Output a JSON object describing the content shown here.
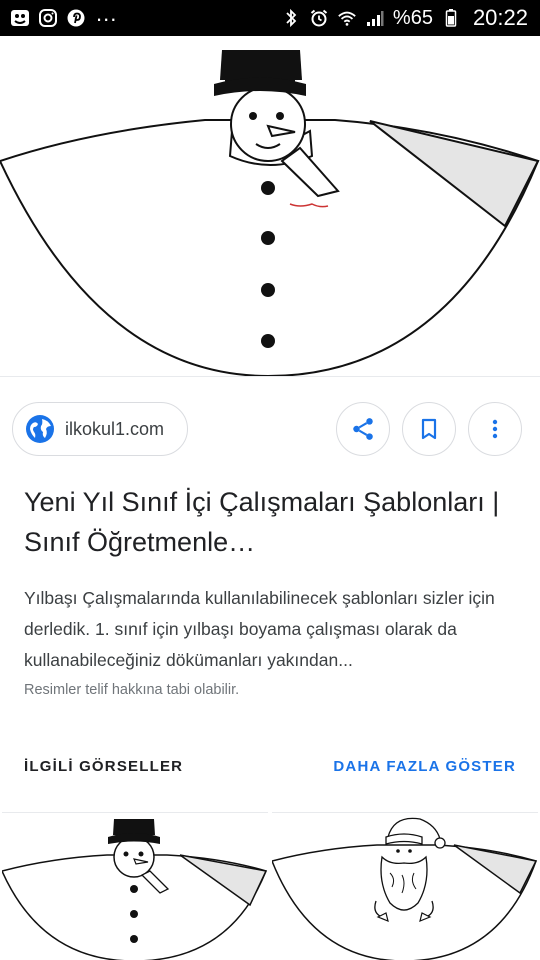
{
  "status_bar": {
    "left_icons": [
      "app-icon",
      "instagram-icon",
      "pinterest-icon"
    ],
    "overflow": "...",
    "right_icons": [
      "bluetooth-icon",
      "alarm-icon",
      "wifi-icon",
      "signal-icon"
    ],
    "battery": "%65",
    "time": "20:22"
  },
  "result": {
    "source": "ilkokul1.com",
    "title": "Yeni Yıl Sınıf İçi Çalışmaları Şablonları | Sınıf Öğretmenle…",
    "description": "Yılbaşı Çalışmalarında kullanılabilinecek şablonları sizler için derledik. 1. sınıf için yılbaşı boyama çalışması olarak da kullanabileceğiniz dökümanları yakından...",
    "copyright_notice": "Resimler telif hakkına tabi olabilir.",
    "actions": [
      "share-icon",
      "bookmark-icon",
      "more-vert-icon"
    ]
  },
  "related": {
    "heading": "İLGİLİ GÖRSELLER",
    "more_label": "DAHA FAZLA GÖSTER"
  },
  "colors": {
    "link": "#1a73e8",
    "status_bar_bg": "#000000",
    "border": "#dadce0"
  }
}
